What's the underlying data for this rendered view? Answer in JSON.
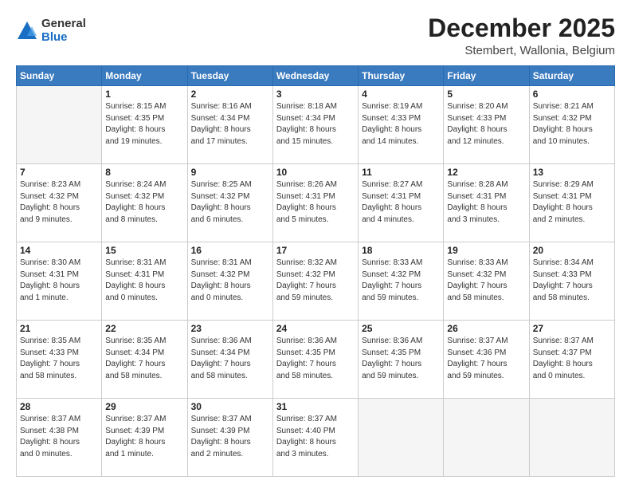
{
  "logo": {
    "general": "General",
    "blue": "Blue"
  },
  "header": {
    "month": "December 2025",
    "location": "Stembert, Wallonia, Belgium"
  },
  "days_of_week": [
    "Sunday",
    "Monday",
    "Tuesday",
    "Wednesday",
    "Thursday",
    "Friday",
    "Saturday"
  ],
  "weeks": [
    [
      {
        "day": "",
        "content": ""
      },
      {
        "day": "1",
        "content": "Sunrise: 8:15 AM\nSunset: 4:35 PM\nDaylight: 8 hours\nand 19 minutes."
      },
      {
        "day": "2",
        "content": "Sunrise: 8:16 AM\nSunset: 4:34 PM\nDaylight: 8 hours\nand 17 minutes."
      },
      {
        "day": "3",
        "content": "Sunrise: 8:18 AM\nSunset: 4:34 PM\nDaylight: 8 hours\nand 15 minutes."
      },
      {
        "day": "4",
        "content": "Sunrise: 8:19 AM\nSunset: 4:33 PM\nDaylight: 8 hours\nand 14 minutes."
      },
      {
        "day": "5",
        "content": "Sunrise: 8:20 AM\nSunset: 4:33 PM\nDaylight: 8 hours\nand 12 minutes."
      },
      {
        "day": "6",
        "content": "Sunrise: 8:21 AM\nSunset: 4:32 PM\nDaylight: 8 hours\nand 10 minutes."
      }
    ],
    [
      {
        "day": "7",
        "content": "Sunrise: 8:23 AM\nSunset: 4:32 PM\nDaylight: 8 hours\nand 9 minutes."
      },
      {
        "day": "8",
        "content": "Sunrise: 8:24 AM\nSunset: 4:32 PM\nDaylight: 8 hours\nand 8 minutes."
      },
      {
        "day": "9",
        "content": "Sunrise: 8:25 AM\nSunset: 4:32 PM\nDaylight: 8 hours\nand 6 minutes."
      },
      {
        "day": "10",
        "content": "Sunrise: 8:26 AM\nSunset: 4:31 PM\nDaylight: 8 hours\nand 5 minutes."
      },
      {
        "day": "11",
        "content": "Sunrise: 8:27 AM\nSunset: 4:31 PM\nDaylight: 8 hours\nand 4 minutes."
      },
      {
        "day": "12",
        "content": "Sunrise: 8:28 AM\nSunset: 4:31 PM\nDaylight: 8 hours\nand 3 minutes."
      },
      {
        "day": "13",
        "content": "Sunrise: 8:29 AM\nSunset: 4:31 PM\nDaylight: 8 hours\nand 2 minutes."
      }
    ],
    [
      {
        "day": "14",
        "content": "Sunrise: 8:30 AM\nSunset: 4:31 PM\nDaylight: 8 hours\nand 1 minute."
      },
      {
        "day": "15",
        "content": "Sunrise: 8:31 AM\nSunset: 4:31 PM\nDaylight: 8 hours\nand 0 minutes."
      },
      {
        "day": "16",
        "content": "Sunrise: 8:31 AM\nSunset: 4:32 PM\nDaylight: 8 hours\nand 0 minutes."
      },
      {
        "day": "17",
        "content": "Sunrise: 8:32 AM\nSunset: 4:32 PM\nDaylight: 7 hours\nand 59 minutes."
      },
      {
        "day": "18",
        "content": "Sunrise: 8:33 AM\nSunset: 4:32 PM\nDaylight: 7 hours\nand 59 minutes."
      },
      {
        "day": "19",
        "content": "Sunrise: 8:33 AM\nSunset: 4:32 PM\nDaylight: 7 hours\nand 58 minutes."
      },
      {
        "day": "20",
        "content": "Sunrise: 8:34 AM\nSunset: 4:33 PM\nDaylight: 7 hours\nand 58 minutes."
      }
    ],
    [
      {
        "day": "21",
        "content": "Sunrise: 8:35 AM\nSunset: 4:33 PM\nDaylight: 7 hours\nand 58 minutes."
      },
      {
        "day": "22",
        "content": "Sunrise: 8:35 AM\nSunset: 4:34 PM\nDaylight: 7 hours\nand 58 minutes."
      },
      {
        "day": "23",
        "content": "Sunrise: 8:36 AM\nSunset: 4:34 PM\nDaylight: 7 hours\nand 58 minutes."
      },
      {
        "day": "24",
        "content": "Sunrise: 8:36 AM\nSunset: 4:35 PM\nDaylight: 7 hours\nand 58 minutes."
      },
      {
        "day": "25",
        "content": "Sunrise: 8:36 AM\nSunset: 4:35 PM\nDaylight: 7 hours\nand 59 minutes."
      },
      {
        "day": "26",
        "content": "Sunrise: 8:37 AM\nSunset: 4:36 PM\nDaylight: 7 hours\nand 59 minutes."
      },
      {
        "day": "27",
        "content": "Sunrise: 8:37 AM\nSunset: 4:37 PM\nDaylight: 8 hours\nand 0 minutes."
      }
    ],
    [
      {
        "day": "28",
        "content": "Sunrise: 8:37 AM\nSunset: 4:38 PM\nDaylight: 8 hours\nand 0 minutes."
      },
      {
        "day": "29",
        "content": "Sunrise: 8:37 AM\nSunset: 4:39 PM\nDaylight: 8 hours\nand 1 minute."
      },
      {
        "day": "30",
        "content": "Sunrise: 8:37 AM\nSunset: 4:39 PM\nDaylight: 8 hours\nand 2 minutes."
      },
      {
        "day": "31",
        "content": "Sunrise: 8:37 AM\nSunset: 4:40 PM\nDaylight: 8 hours\nand 3 minutes."
      },
      {
        "day": "",
        "content": ""
      },
      {
        "day": "",
        "content": ""
      },
      {
        "day": "",
        "content": ""
      }
    ]
  ]
}
